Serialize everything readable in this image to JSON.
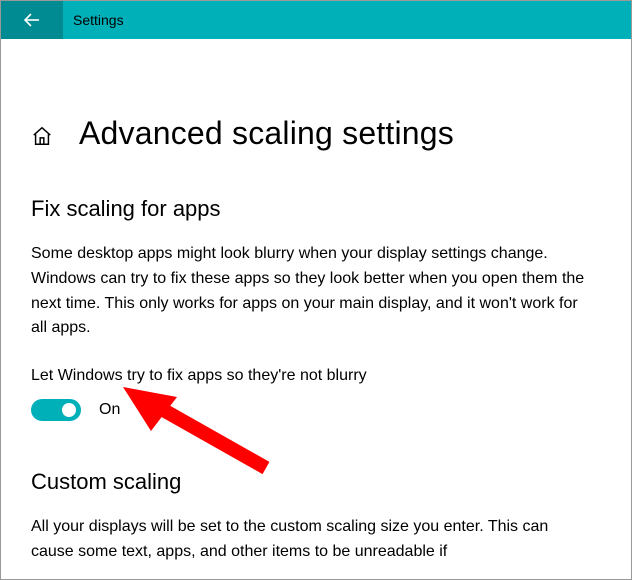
{
  "titlebar": {
    "title": "Settings"
  },
  "page": {
    "title": "Advanced scaling settings"
  },
  "section_fix": {
    "heading": "Fix scaling for apps",
    "description": "Some desktop apps might look blurry when your display settings change. Windows can try to fix these apps so they look better when you open them the next time. This only works for apps on your main display, and it won't work for all apps.",
    "toggle_label": "Let Windows try to fix apps so they're not blurry",
    "toggle_state": "On"
  },
  "section_custom": {
    "heading": "Custom scaling",
    "description": "All your displays will be set to the custom scaling size you enter. This can cause some text, apps, and other items to be unreadable if"
  },
  "colors": {
    "accent": "#00b0b9",
    "accent_dark": "#008a91",
    "annotation": "#ff0000"
  }
}
